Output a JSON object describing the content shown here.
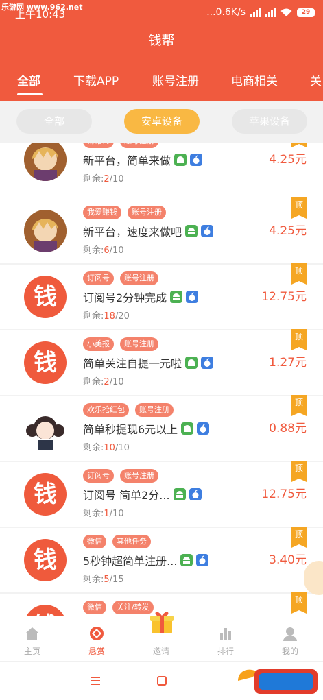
{
  "status": {
    "time": "上午10:43",
    "speed": "...0.6K/s",
    "battery": "29",
    "watermark": "乐游网 www.962.net"
  },
  "app": {
    "title": "钱帮"
  },
  "tabs": [
    "全部",
    "下载APP",
    "账号注册",
    "电商相关",
    "关"
  ],
  "filters": [
    "全部",
    "安卓设备",
    "苹果设备"
  ],
  "tasks": [
    {
      "tags": [
        "易帮帮",
        "账号注册"
      ],
      "title": "新平台，简单来做",
      "remaining_label": "剩余:",
      "remaining": "2",
      "total": "/10",
      "price": "4.25元",
      "pin": "顶",
      "avatar": "anime"
    },
    {
      "tags": [
        "我爱赚钱",
        "账号注册"
      ],
      "title": "新平台，速度来做吧",
      "remaining_label": "剩余:",
      "remaining": "6",
      "total": "/10",
      "price": "4.25元",
      "pin": "顶",
      "avatar": "anime"
    },
    {
      "tags": [
        "订阅号",
        "账号注册"
      ],
      "title": "订阅号2分钟完成",
      "remaining_label": "剩余:",
      "remaining": "18",
      "total": "/20",
      "price": "12.75元",
      "pin": "顶",
      "avatar": "qian"
    },
    {
      "tags": [
        "小美报",
        "账号注册"
      ],
      "title": "简单关注自提一元啦",
      "remaining_label": "剩余:",
      "remaining": "2",
      "total": "/10",
      "price": "1.27元",
      "pin": "顶",
      "avatar": "qian"
    },
    {
      "tags": [
        "欢乐抢红包",
        "账号注册"
      ],
      "title": "简单秒提现6元以上",
      "remaining_label": "剩余:",
      "remaining": "10",
      "total": "/10",
      "price": "0.88元",
      "pin": "顶",
      "avatar": "girl"
    },
    {
      "tags": [
        "订阅号",
        "账号注册"
      ],
      "title": "订阅号 简单2分...",
      "remaining_label": "剩余:",
      "remaining": "1",
      "total": "/10",
      "price": "12.75元",
      "pin": "顶",
      "avatar": "qian"
    },
    {
      "tags": [
        "微信",
        "其他任务"
      ],
      "title": "5秒钟超简单注册...",
      "remaining_label": "剩余:",
      "remaining": "5",
      "total": "/15",
      "price": "3.40元",
      "pin": "顶",
      "avatar": "qian"
    },
    {
      "tags": [
        "微信",
        "关注/转发"
      ],
      "title": "",
      "remaining_label": "",
      "remaining": "",
      "total": "",
      "price": "",
      "pin": "顶",
      "avatar": "qian"
    }
  ],
  "avatar_glyph": "钱",
  "bottom_nav": [
    "主页",
    "悬赏",
    "邀请",
    "排行",
    "我的"
  ],
  "colors": {
    "brand": "#f05a3e",
    "accent": "#f9b843",
    "tag": "#f4826b",
    "android": "#4cb152",
    "ios": "#3e7ee0",
    "pin": "#f5a623"
  }
}
